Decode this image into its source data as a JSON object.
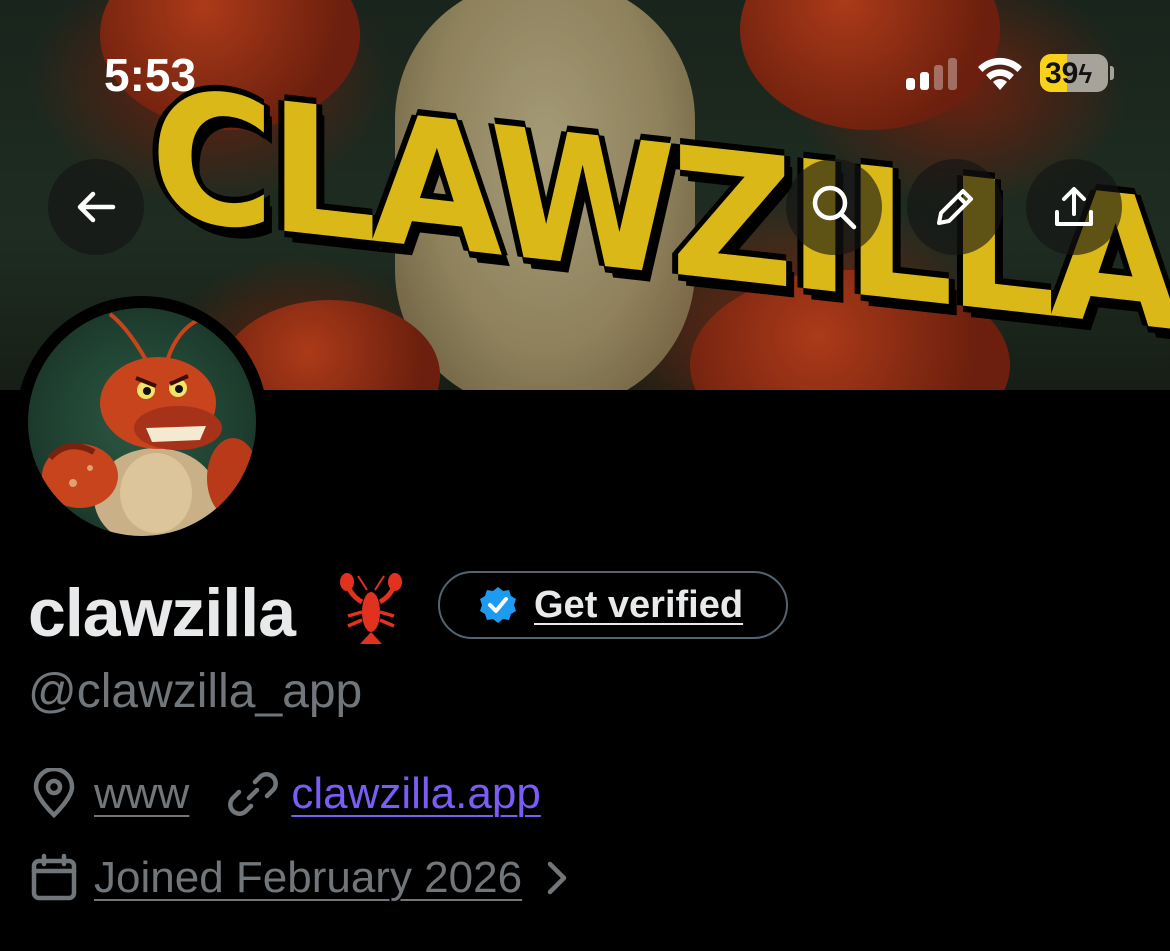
{
  "status_bar": {
    "time": "5:53",
    "battery_percent": "39",
    "battery_level": 0.39,
    "signal_bars_active": 2,
    "signal_bars_total": 4,
    "battery_color": "#f8d21a"
  },
  "banner": {
    "title_text": "CLAWZILLA"
  },
  "nav": {
    "back_icon": "arrow-left-icon",
    "search_icon": "search-icon",
    "edit_icon": "pencil-icon",
    "share_icon": "share-upload-icon"
  },
  "profile": {
    "display_name": "clawzilla",
    "name_emoji": "lobster-emoji",
    "verify_button_label": "Get verified",
    "verify_icon": "verified-badge-icon",
    "handle": "@clawzilla_app",
    "location": "www",
    "website": "clawzilla.app",
    "joined": "Joined February 2026"
  },
  "colors": {
    "background": "#000000",
    "primary_text": "#e7e9ea",
    "secondary_text": "#71767b",
    "link": "#7b5cf5",
    "verified_blue": "#1d9bf0",
    "pill_border": "#536471"
  }
}
